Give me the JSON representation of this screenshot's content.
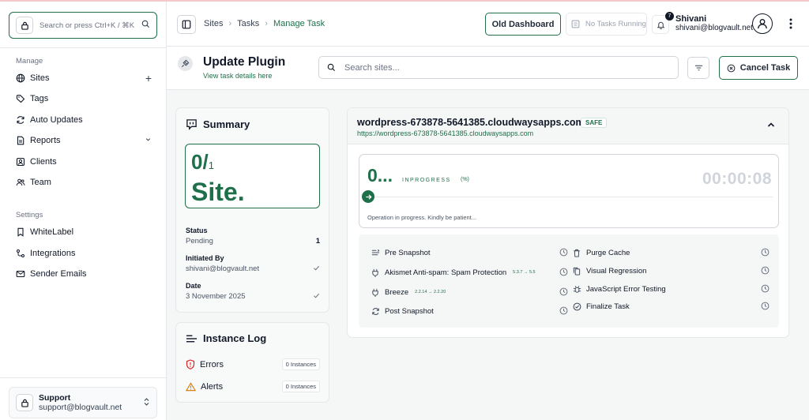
{
  "app": {
    "search_placeholder": "Search or press Ctrl+K / ⌘K",
    "manage_label": "Manage",
    "settings_label": "Settings",
    "nav_manage": [
      {
        "label": "Sites",
        "icon": "globe-icon",
        "right": "+"
      },
      {
        "label": "Tags",
        "icon": "tag-icon"
      },
      {
        "label": "Auto Updates",
        "icon": "refresh-icon"
      },
      {
        "label": "Reports",
        "icon": "report-icon",
        "right": "⌄"
      },
      {
        "label": "Clients",
        "icon": "clients-icon"
      },
      {
        "label": "Team",
        "icon": "team-icon"
      }
    ],
    "nav_settings": [
      {
        "label": "WhiteLabel",
        "icon": "bookmark-icon"
      },
      {
        "label": "Integrations",
        "icon": "integrations-icon"
      },
      {
        "label": "Sender Emails",
        "icon": "mail-icon"
      }
    ],
    "support": {
      "title": "Support",
      "email": "support@blogvault.net"
    }
  },
  "header": {
    "breadcrumbs": [
      "Sites",
      "Tasks",
      "Manage Task"
    ],
    "old_dashboard": "Old Dashboard",
    "no_tasks": "No Tasks Running",
    "notification_count": "7",
    "user_name": "Shivani",
    "user_email": "shivani@blogvault.net"
  },
  "page": {
    "title": "Update Plugin",
    "subtitle": "View task details here",
    "search_placeholder": "Search sites...",
    "cancel_label": "Cancel Task"
  },
  "summary": {
    "title": "Summary",
    "done": "0/",
    "total": "1",
    "unit": "Site.",
    "status_label": "Status",
    "status_value": "Pending",
    "status_count": "1",
    "initiated_label": "Initiated By",
    "initiated_value": "shivani@blogvault.net",
    "date_label": "Date",
    "date_value": "3 November 2025"
  },
  "instance_log": {
    "title": "Instance Log",
    "errors_label": "Errors",
    "errors_count": "0 Instances",
    "alerts_label": "Alerts",
    "alerts_count": "0 Instances"
  },
  "site": {
    "name": "wordpress-673878-5641385.cloudwaysapps.com",
    "badge": "SAFE",
    "url": "https://wordpress-673878-5641385.cloudwaysapps.com",
    "progress_text": "0...",
    "state": "INPROGRESS",
    "unit": "(%)",
    "timer": "00:00:08",
    "note": "Operation in progress. Kindly be patient...",
    "steps_left": [
      {
        "label": "Pre Snapshot",
        "version": ""
      },
      {
        "label": "Akismet Anti-spam: Spam Protection",
        "version": "5.3.7 → 5.5"
      },
      {
        "label": "Breeze",
        "version": "2.2.14 → 2.2.20"
      },
      {
        "label": "Post Snapshot",
        "version": ""
      }
    ],
    "steps_right": [
      {
        "label": "Purge Cache"
      },
      {
        "label": "Visual Regression"
      },
      {
        "label": "JavaScript Error Testing"
      },
      {
        "label": "Finalize Task"
      }
    ]
  },
  "colors": {
    "accent": "#1f6f4a",
    "error": "#dc2626",
    "warning": "#d97706"
  }
}
